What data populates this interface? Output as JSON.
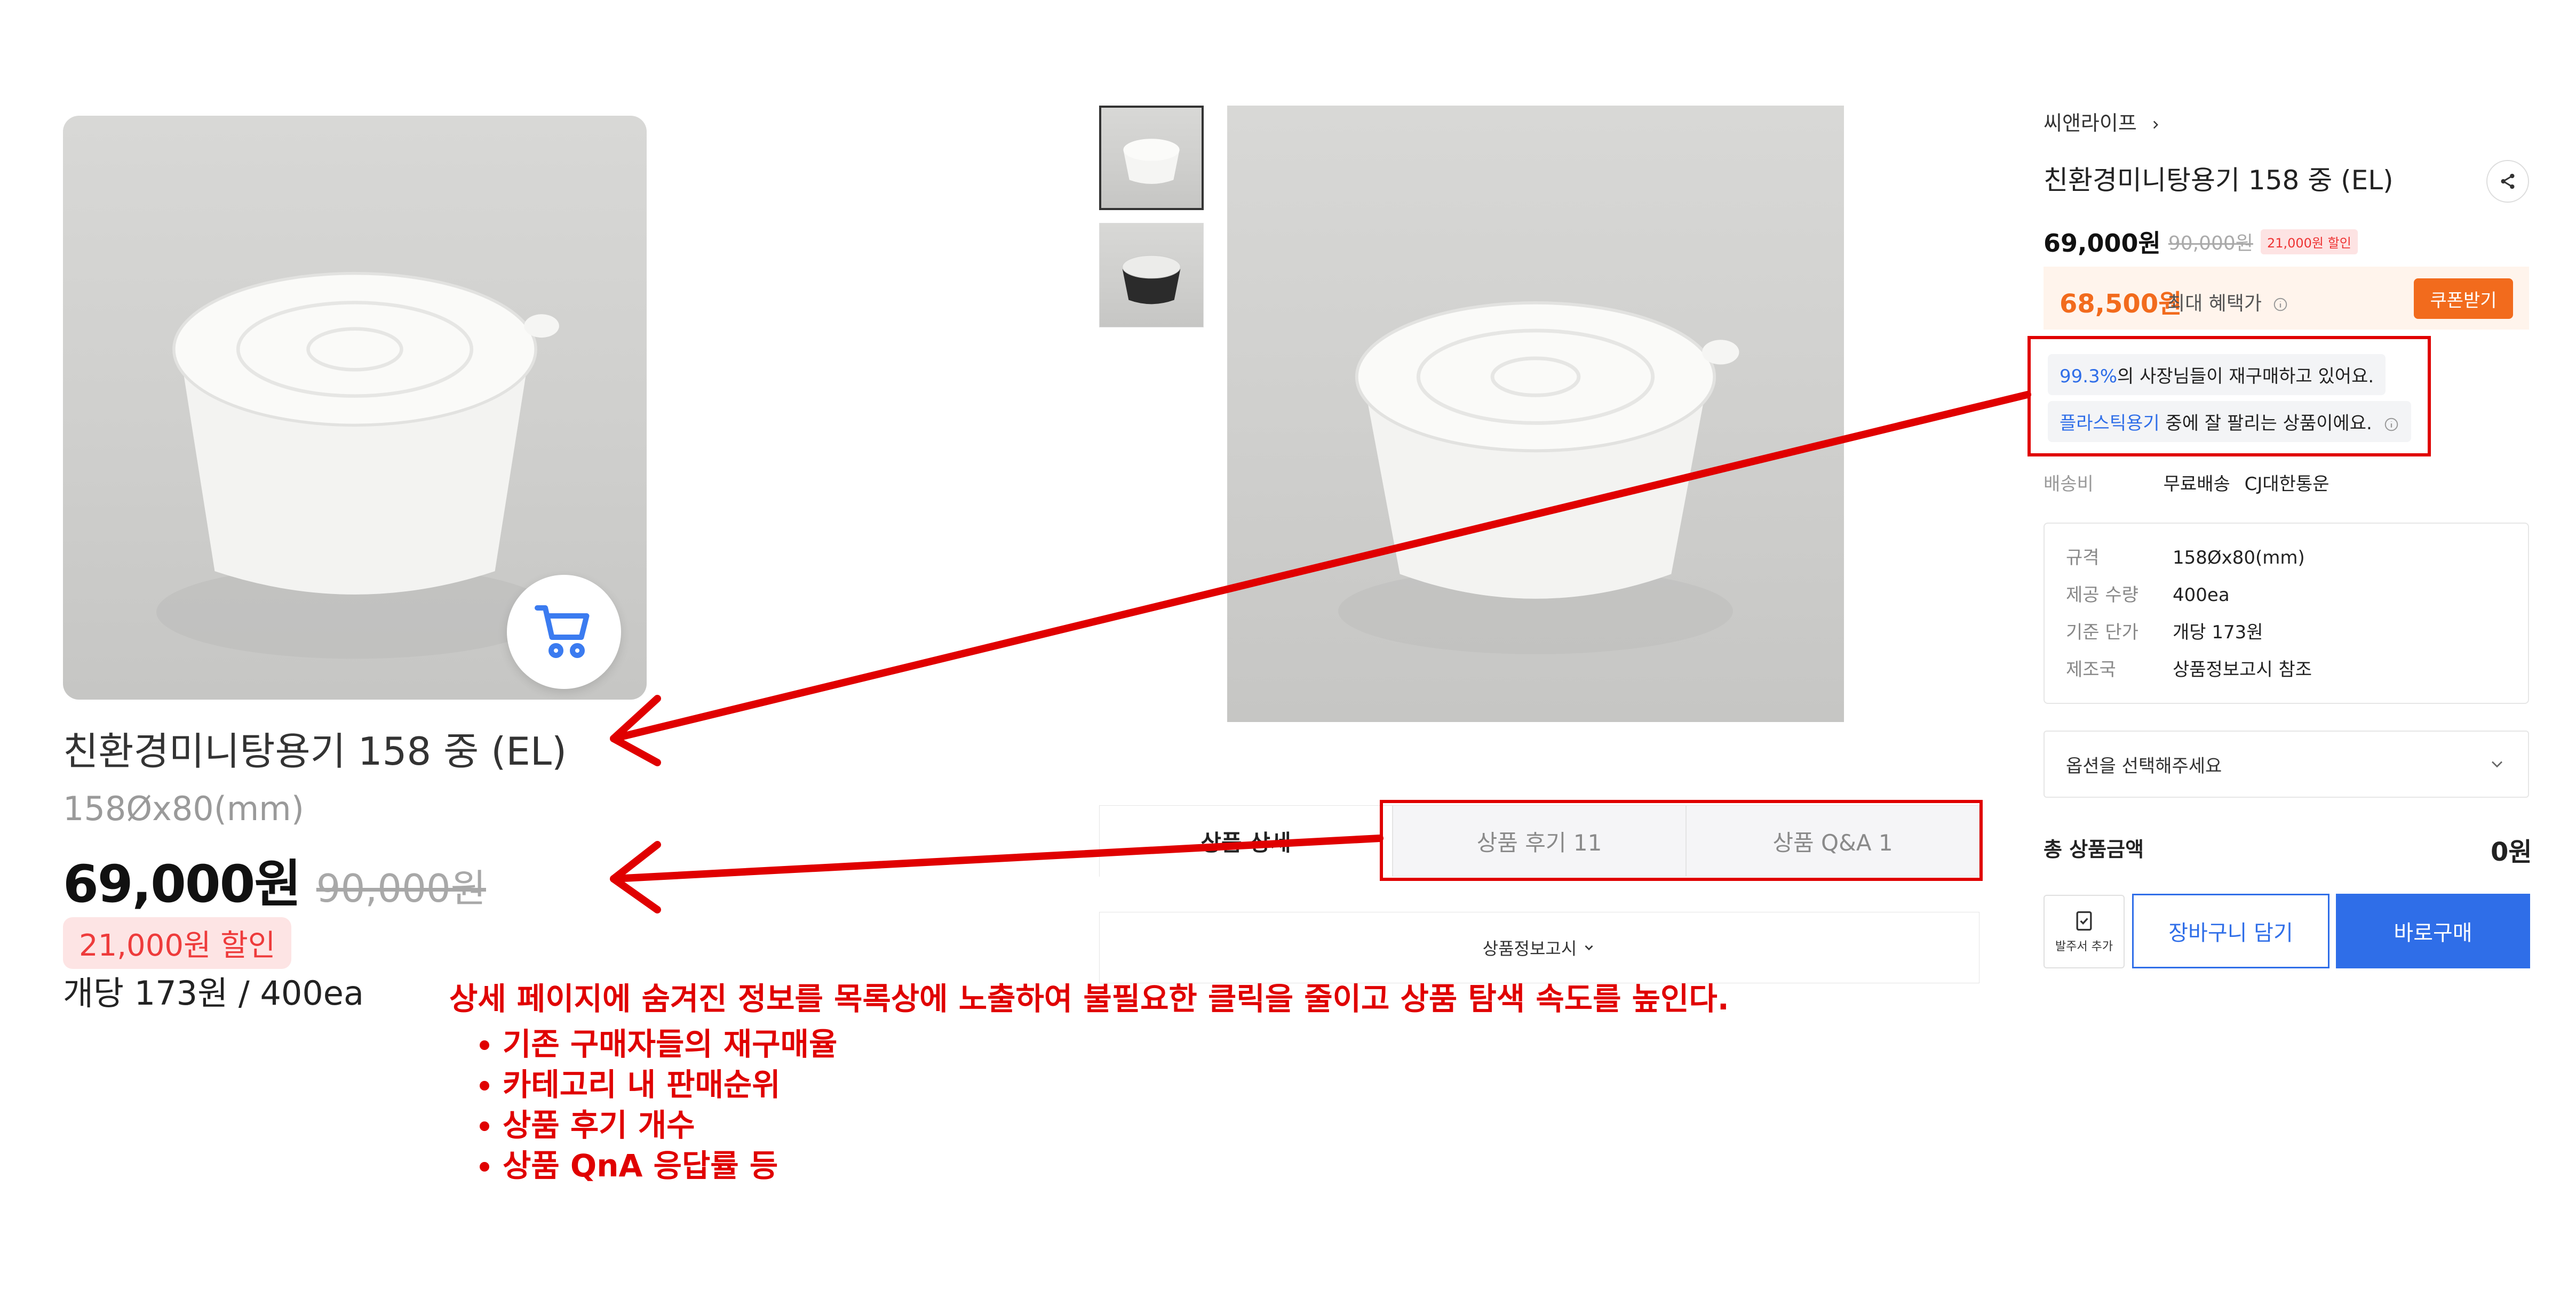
{
  "card": {
    "title": "친환경미니탕용기 158 중 (EL)",
    "spec": "158Øx80(mm)",
    "price": "69,000원",
    "original_price": "90,000원",
    "discount": "21,000원 할인",
    "unit_info": "개당 173원 / 400ea"
  },
  "tabs": [
    {
      "label": "상품 상세"
    },
    {
      "label": "상품 후기 11"
    },
    {
      "label": "상품 Q&A 1"
    }
  ],
  "notice": {
    "label": "상품정보고시",
    "icon": "chevron-down-icon"
  },
  "detail": {
    "brand": "씨앤라이프",
    "title": "친환경미니탕용기 158 중 (EL)",
    "price": "69,000원",
    "original_price": "90,000원",
    "discount_badge": "21,000원 할인",
    "benefit_price": "68,500원",
    "benefit_label": "최대 혜택가",
    "coupon_button": "쿠폰받기",
    "stats": {
      "repurchase_rate": "99.3%",
      "repurchase_text": "의 사장님들이 재구매하고 있어요.",
      "category": "플라스틱용기",
      "category_text": " 중에 잘 팔리는 상품이에요."
    },
    "shipping": {
      "label": "배송비",
      "value": "무료배송",
      "carrier": "CJ대한통운"
    },
    "specs": [
      {
        "key": "규격",
        "value": "158Øx80(mm)"
      },
      {
        "key": "제공 수량",
        "value": "400ea"
      },
      {
        "key": "기준 단가",
        "value": "개당 173원"
      },
      {
        "key": "제조국",
        "value": "상품정보고시 참조"
      }
    ],
    "option_placeholder": "옵션을 선택해주세요",
    "total_label": "총 상품금액",
    "total_value": "0원",
    "order_sheet_label": "발주서 추가",
    "cart_button": "장바구니 담기",
    "buy_button": "바로구매"
  },
  "annotation": {
    "main": "상세 페이지에 숨겨진 정보를 목록상에 노출하여 불필요한 클릭을 줄이고 상품 탐색 속도를 높인다.",
    "bullets": [
      "기존 구매자들의 재구매율",
      "카테고리 내 판매순위",
      "상품 후기 개수",
      "상품 QnA 응답률 등"
    ]
  },
  "colors": {
    "accent": "#2f6ee8",
    "benefit": "#f26b1d",
    "annotation": "#e00000",
    "discount": "#ee3b3b"
  }
}
